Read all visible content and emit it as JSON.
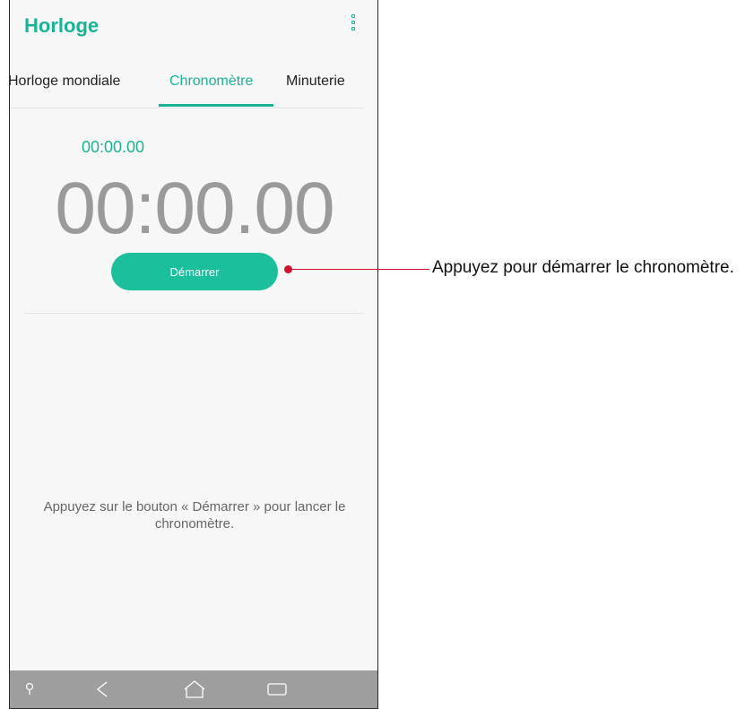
{
  "app": {
    "title": "Horloge"
  },
  "tabs": [
    {
      "label": "Horloge mondiale",
      "active": false
    },
    {
      "label": "Chronomètre",
      "active": true
    },
    {
      "label": "Minuterie",
      "active": false
    }
  ],
  "stopwatch": {
    "lap_time": "00:00.00",
    "main_time": "00:00.00",
    "start_label": "Démarrer",
    "hint": "Appuyez sur le bouton « Démarrer » pour lancer le chronomètre."
  },
  "annotation": {
    "text": "Appuyez pour démarrer le chronomètre."
  },
  "icons": {
    "menu": "more-vert-icon",
    "search": "search-icon",
    "back": "back-icon",
    "home": "home-icon",
    "recent": "recent-apps-icon"
  },
  "colors": {
    "accent": "#1ab394",
    "button": "#1bbf9c",
    "navbar": "#9e9e9e",
    "callout": "#d0112b"
  }
}
